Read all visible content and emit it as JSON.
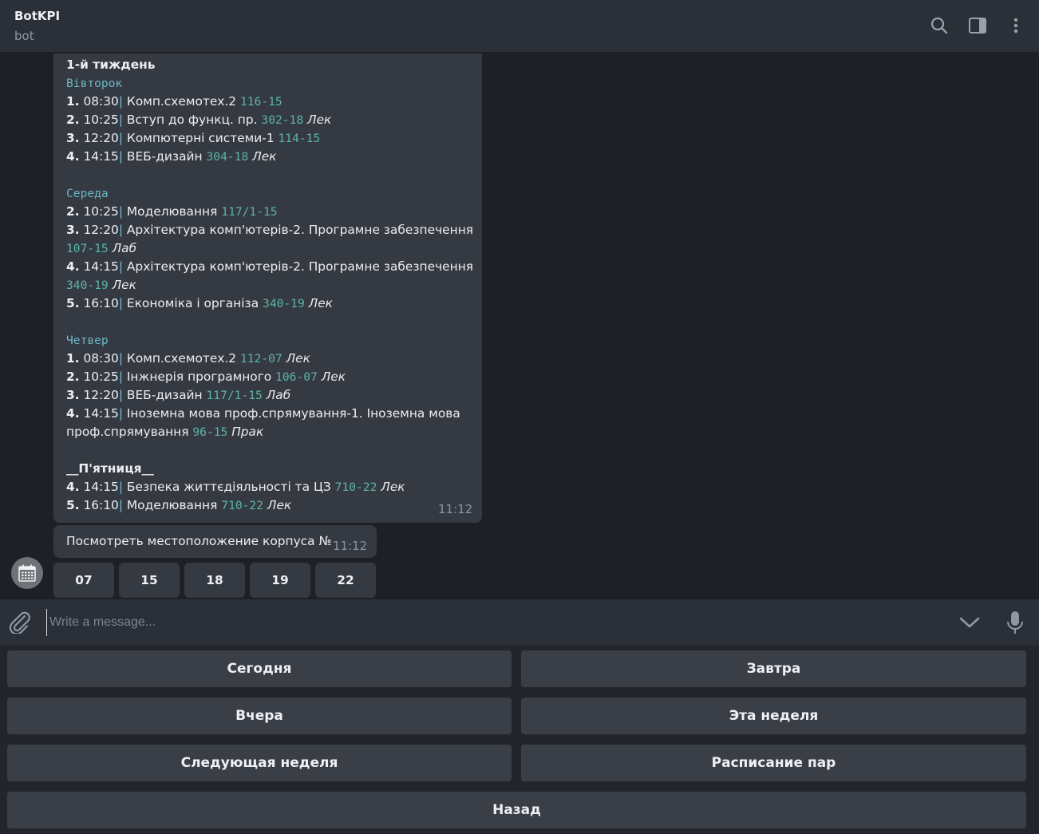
{
  "header": {
    "title": "BotKPI",
    "subtitle": "bot"
  },
  "schedule": {
    "week": "1-й тиждень",
    "lines": [
      {
        "kind": "day",
        "text": "Вівторок"
      },
      {
        "kind": "lesson",
        "n": "1.",
        "time": " 08:30",
        "sep": "|",
        "subject": " Комп.схемотех.2 ",
        "room": "116-15",
        "type": ""
      },
      {
        "kind": "lesson",
        "n": "2.",
        "time": " 10:25",
        "sep": "|",
        "subject": " Вступ до функц. пр. ",
        "room": "302-18",
        "type": " Лек"
      },
      {
        "kind": "lesson",
        "n": "3.",
        "time": " 12:20",
        "sep": "|",
        "subject": " Компютерні системи-1 ",
        "room": "114-15",
        "type": ""
      },
      {
        "kind": "lesson",
        "n": "4.",
        "time": " 14:15",
        "sep": "|",
        "subject": " ВЕБ-дизайн ",
        "room": "304-18",
        "type": " Лек"
      },
      {
        "kind": "blank"
      },
      {
        "kind": "day",
        "text": "Середа"
      },
      {
        "kind": "lesson",
        "n": "2.",
        "time": " 10:25",
        "sep": "|",
        "subject": " Моделювання ",
        "room": "117/1-15",
        "type": ""
      },
      {
        "kind": "lesson",
        "n": "3.",
        "time": " 12:20",
        "sep": "|",
        "subject": " Архітектура комп'ютерів-2. Програмне забезпечення",
        "room": "",
        "type": ""
      },
      {
        "kind": "cont",
        "subject": "",
        "room": "107-15",
        "type": " Лаб"
      },
      {
        "kind": "lesson",
        "n": "4.",
        "time": " 14:15",
        "sep": "|",
        "subject": " Архітектура комп'ютерів-2. Програмне забезпечення",
        "room": "",
        "type": ""
      },
      {
        "kind": "cont",
        "subject": "",
        "room": "340-19",
        "type": " Лек"
      },
      {
        "kind": "lesson",
        "n": "5.",
        "time": " 16:10",
        "sep": "|",
        "subject": " Економіка і організа ",
        "room": "340-19",
        "type": " Лек"
      },
      {
        "kind": "blank"
      },
      {
        "kind": "day",
        "text": "Четвер"
      },
      {
        "kind": "lesson",
        "n": "1.",
        "time": " 08:30",
        "sep": "|",
        "subject": " Комп.схемотех.2 ",
        "room": "112-07",
        "type": " Лек"
      },
      {
        "kind": "lesson",
        "n": "2.",
        "time": " 10:25",
        "sep": "|",
        "subject": " Інжнерія програмного ",
        "room": "106-07",
        "type": " Лек"
      },
      {
        "kind": "lesson",
        "n": "3.",
        "time": " 12:20",
        "sep": "|",
        "subject": " ВЕБ-дизайн ",
        "room": "117/1-15",
        "type": " Лаб"
      },
      {
        "kind": "lesson",
        "n": "4.",
        "time": " 14:15",
        "sep": "|",
        "subject": " Іноземна мова проф.спрямування-1. Іноземна мова",
        "room": "",
        "type": ""
      },
      {
        "kind": "cont",
        "subject": "проф.спрямування ",
        "room": "96-15",
        "type": " Прак"
      },
      {
        "kind": "blank"
      },
      {
        "kind": "heading",
        "text": "__П'ятниця__"
      },
      {
        "kind": "lesson",
        "n": "4.",
        "time": " 14:15",
        "sep": "|",
        "subject": " Безпека життєдіяльності та ЦЗ ",
        "room": "710-22",
        "type": " Лек"
      },
      {
        "kind": "lesson",
        "n": "5.",
        "time": " 16:10",
        "sep": "|",
        "subject": " Моделювання ",
        "room": "710-22",
        "type": " Лек"
      }
    ],
    "time": "11:12"
  },
  "location_message": {
    "text": "Посмотреть местоположение корпуса №",
    "time": "11:12"
  },
  "inline_buttons": [
    "07",
    "15",
    "18",
    "19",
    "22"
  ],
  "composer": {
    "placeholder": "Write a message..."
  },
  "keyboard": {
    "today": "Сегодня",
    "tomorrow": "Завтра",
    "yesterday": "Вчера",
    "this_week": "Эта неделя",
    "next_week": "Следующая неделя",
    "pairs_schedule": "Расписание пар",
    "back": "Назад"
  },
  "icons": {
    "search": "search-icon",
    "sidebar": "sidebar-toggle-icon",
    "menu": "more-vertical-icon",
    "avatar": "calendar-icon",
    "attach": "paperclip-icon",
    "scroll": "chevron-down-icon",
    "mic": "microphone-icon"
  },
  "colors": {
    "background": "#1d2127",
    "bubble": "#353a42",
    "room": "#5cb5a3",
    "day": "#6bb6c5"
  }
}
